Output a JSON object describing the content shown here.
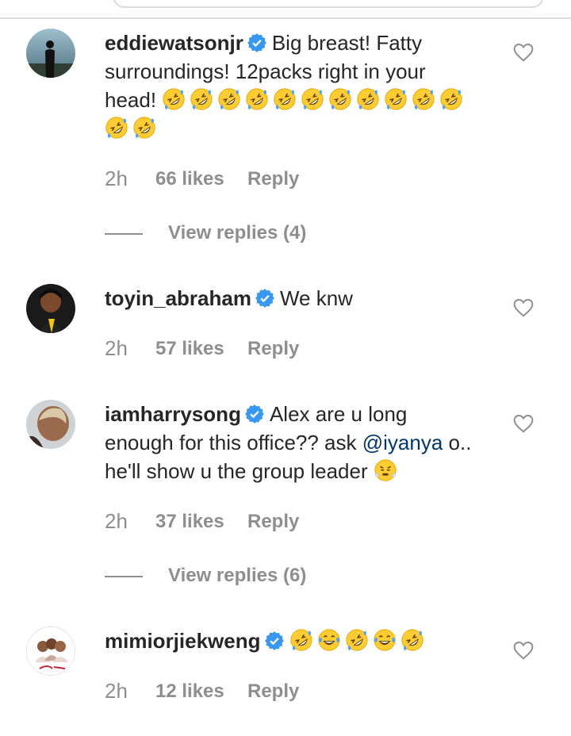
{
  "comments": [
    {
      "username": "eddiewatsonjr",
      "text": "Big breast! Fatty surroundings! 12packs right in your head!",
      "mention": "",
      "text_after": "",
      "emojis": [
        "rofl",
        "rofl",
        "rofl",
        "rofl",
        "rofl",
        "rofl",
        "rofl",
        "rofl",
        "rofl",
        "rofl",
        "rofl",
        "rofl",
        "rofl"
      ],
      "time": "2h",
      "likes": "66 likes",
      "reply": "Reply",
      "view_replies": "View replies (4)"
    },
    {
      "username": "toyin_abraham",
      "text": "We knw",
      "mention": "",
      "text_after": "",
      "emojis": [],
      "time": "2h",
      "likes": "57 likes",
      "reply": "Reply",
      "view_replies": ""
    },
    {
      "username": "iamharrysong",
      "text": "Alex are u long enough for this office?? ask",
      "mention": "@iyanya",
      "text_after": "o.. he'll show u the group leader",
      "emojis": [
        "steam"
      ],
      "time": "2h",
      "likes": "37 likes",
      "reply": "Reply",
      "view_replies": "View replies (6)"
    },
    {
      "username": "mimiorjiekweng",
      "text": "",
      "mention": "",
      "text_after": "",
      "emojis": [
        "rofl",
        "joy",
        "rofl",
        "joy",
        "rofl"
      ],
      "time": "2h",
      "likes": "12 likes",
      "reply": "Reply",
      "view_replies": ""
    }
  ],
  "colors": {
    "verified": "#3897f0",
    "muted": "#8e8e8e",
    "text": "#262626",
    "mention": "#00376b"
  },
  "icons": {
    "verified": "verified-badge-icon",
    "like": "heart-outline-icon"
  }
}
